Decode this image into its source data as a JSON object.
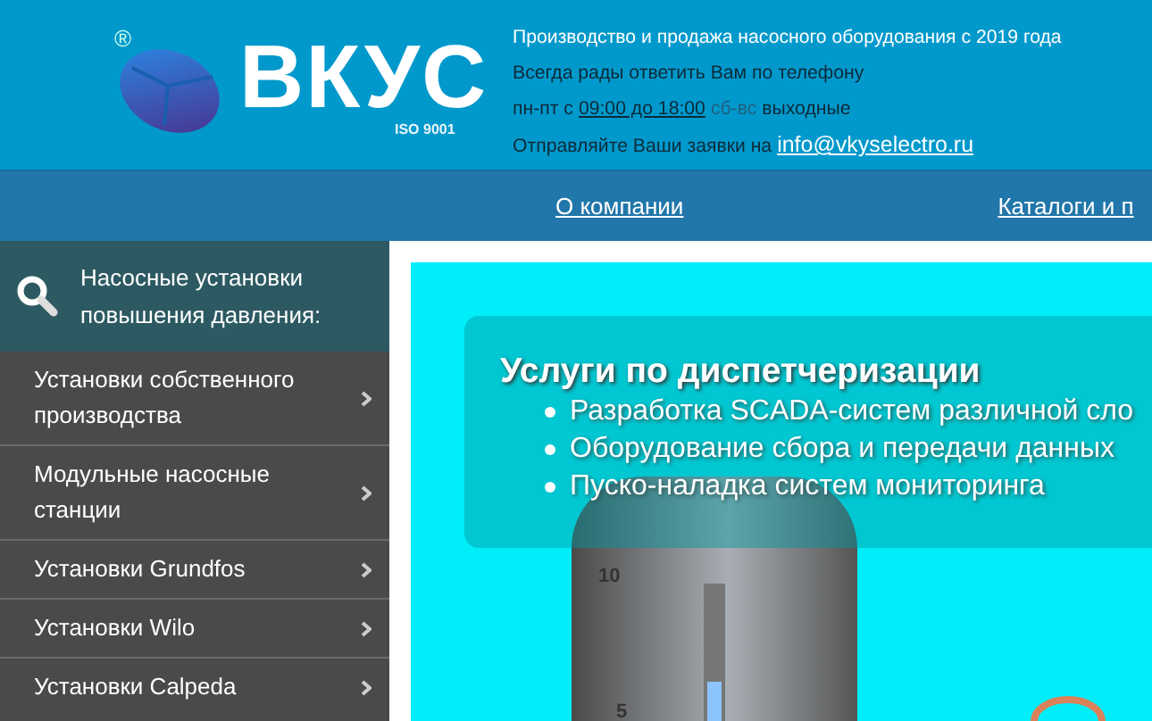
{
  "header": {
    "logo": {
      "registered_mark": "®",
      "name": "ВКУС",
      "certification": "ISO 9001"
    },
    "tagline": "Производство и продажа насосного оборудования с 2019 года",
    "phone_line": "Всегда рады ответить Вам по телефону",
    "hours": {
      "weekdays_prefix": "пн-пт с",
      "weekdays_hours": "09:00 до 18:00",
      "weekend": "сб-вс",
      "weekend_suffix": "выходные"
    },
    "email_line": {
      "text": "Отправляйте Ваши заявки на",
      "email": "info@vkyselectro.ru"
    }
  },
  "nav": [
    {
      "label": "О компании"
    },
    {
      "label": "Каталоги и п"
    }
  ],
  "sidebar": {
    "title": "Насосные установки повышения давления:",
    "items": [
      {
        "label": "Установки собственного производства"
      },
      {
        "label": "Модульные насосные станции"
      },
      {
        "label": "Установки Grundfos"
      },
      {
        "label": "Установки Wilo"
      },
      {
        "label": "Установки Calpeda"
      }
    ]
  },
  "banner": {
    "title": "Услуги по диспетчеризации",
    "bullets": [
      "Разработка SCADA-систем различной сло",
      "Оборудование сбора и передачи данных",
      "Пуско-наладка систем мониторинга"
    ],
    "tank": {
      "labels": [
        "10",
        "5"
      ]
    }
  }
}
